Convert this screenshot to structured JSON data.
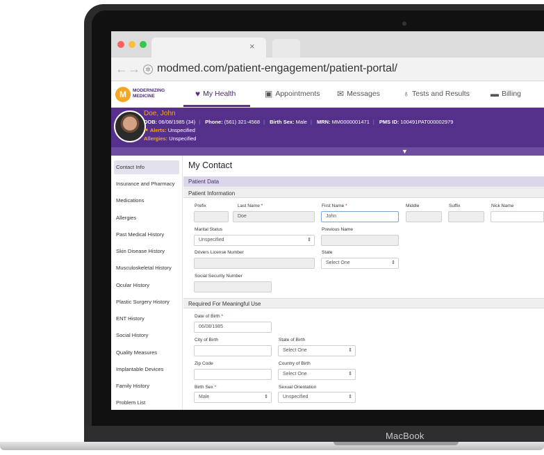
{
  "device": {
    "brand": "MacBook"
  },
  "browser": {
    "url": "modmed.com/patient-engagement/patient-portal/",
    "tab_close": "×",
    "back_glyph": "←",
    "forward_glyph": "→"
  },
  "app": {
    "logo_text": "MODERNIZING MEDICINE",
    "logo_mark": "M",
    "nav": [
      {
        "label": "My Health",
        "icon": "heart-icon",
        "glyph": "♥"
      },
      {
        "label": "Appointments",
        "icon": "calendar-icon",
        "glyph": "▣"
      },
      {
        "label": "Messages",
        "icon": "chat-icon",
        "glyph": "✉"
      },
      {
        "label": "Tests and Results",
        "icon": "microscope-icon",
        "glyph": "♁"
      },
      {
        "label": "Billing",
        "icon": "card-icon",
        "glyph": "▬"
      }
    ]
  },
  "patient": {
    "name": "Doe, John",
    "dob_label": "DOB:",
    "dob_value": "06/08/1985 (34)",
    "phone_label": "Phone:",
    "phone_value": "(561) 321-4568",
    "sex_label": "Birth Sex:",
    "sex_value": "Male",
    "mrn_label": "MRN:",
    "mrn_value": "MM0000001471",
    "pms_label": "PMS ID:",
    "pms_value": "100491PAT000002979",
    "alerts_label": "Alerts:",
    "alerts_value": "Unspecified",
    "allergies_label": "Allergies:",
    "allergies_value": "Unspecified"
  },
  "sidebar": {
    "items": [
      "Contact Info",
      "Insurance and Pharmacy",
      "Medications",
      "Allergies",
      "Past Medical History",
      "Skin Disease History",
      "Musculoskeletal History",
      "Ocular History",
      "Plastic Surgery History",
      "ENT History",
      "Social History",
      "Quality Measures",
      "Implantable Devices",
      "Family History",
      "Problem List"
    ]
  },
  "main": {
    "title": "My Contact",
    "section_patient_data": "Patient Data",
    "section_patient_info": "Patient Information",
    "section_meaningful_use": "Required For Meaningful Use",
    "labels": {
      "prefix": "Prefix",
      "last_name": "Last Name",
      "first_name": "First Name",
      "middle": "Middle",
      "suffix": "Suffix",
      "nick_name": "Nick Name",
      "marital_status": "Marital Status",
      "previous_name": "Previous Name",
      "drivers_license": "Drivers License Number",
      "state": "State",
      "ssn": "Social Security Number",
      "dob": "Date of Birth",
      "city_of_birth": "City of Birth",
      "state_of_birth": "State of Birth",
      "zip_code": "Zip Code",
      "country_of_birth": "Country of Birth",
      "birth_sex": "Birth Sex",
      "sexual_orientation": "Sexual Orientation"
    },
    "values": {
      "last_name": "Doe",
      "first_name": "John",
      "marital_status": "Unspecified",
      "state": "Select One",
      "dob": "06/08/1985",
      "state_of_birth": "Select One",
      "country_of_birth": "Select One",
      "birth_sex": "Male",
      "sexual_orientation": "Unspecified"
    },
    "required_marker": "*",
    "select_chevron": "⇕"
  },
  "colors": {
    "brand_purple": "#55308a",
    "accent_orange": "#f5a623"
  }
}
